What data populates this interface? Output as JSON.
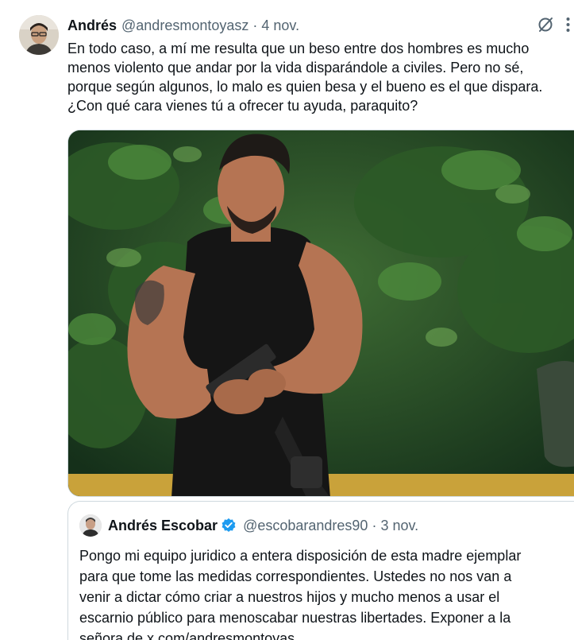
{
  "tweet": {
    "author_name": "Andrés",
    "author_handle": "@andresmontoyasz",
    "separator": "·",
    "date": "4 nov.",
    "text_lines": [
      "En todo caso, a mí me resulta que un beso entre dos hombres es mucho",
      "menos violento que andar por la vida disparándole a civiles. Pero no sé,",
      "porque según algunos, lo malo es quien besa y el bueno es el que dispara.",
      "¿Con qué cara vienes tú a ofrecer tu ayuda, paraquito?"
    ],
    "icons": {
      "grok": "grok-icon",
      "more": "more-vertical-icon"
    }
  },
  "quoted": {
    "author_name": "Andrés Escobar",
    "verified": true,
    "author_handle": "@escobarandres90",
    "separator": "·",
    "date": "3 nov.",
    "text_lines": [
      "Pongo mi equipo juridico a entera disposición de esta madre ejemplar",
      "para que tome las medidas correspondientes. Ustedes no nos van a",
      "venir a dictar cómo criar a nuestros hijos y mucho menos a usar el",
      "escarnio público para menoscabar nuestras libertades. Exponer a la",
      "señora de x.com/andresmontoyas..."
    ]
  },
  "colors": {
    "text": "#0f1419",
    "secondary": "#536471",
    "border": "#cfd9de",
    "verified": "#1d9bf0"
  }
}
